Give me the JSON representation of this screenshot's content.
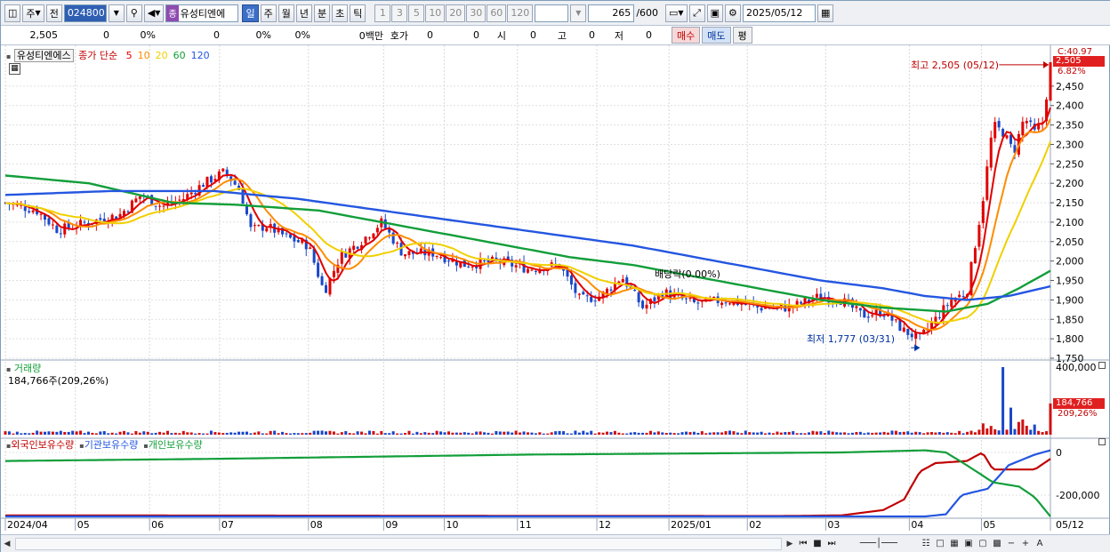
{
  "toolbar": {
    "market": "주",
    "prev_label": "전",
    "code": "024800",
    "search_icon": "search-icon",
    "tag": "종",
    "stock_name": "유성티엔에",
    "periods": [
      "일",
      "주",
      "월",
      "년",
      "분",
      "초",
      "틱"
    ],
    "selected_period": "일",
    "intervals": [
      "1",
      "3",
      "5",
      "10",
      "20",
      "30",
      "60",
      "120"
    ],
    "count": "265",
    "count_total": "/600",
    "date": "2025/05/12"
  },
  "quote": {
    "price": "2,505",
    "change": "0",
    "change_pct": "0%",
    "volume": "0",
    "vol_pct1": "0%",
    "vol_pct2": "0%",
    "amount": "0백만",
    "hoga_label": "호가",
    "hoga_1": "0",
    "hoga_2": "0",
    "open_label": "시",
    "open": "0",
    "high_label": "고",
    "high": "0",
    "low_label": "저",
    "low": "0",
    "buy": "매수",
    "sell": "매도",
    "flat": "평"
  },
  "price_pane": {
    "stock_label": "유성티엔에스",
    "type_label": "종가 단순",
    "ma_labels": [
      "5",
      "10",
      "20",
      "60",
      "120"
    ],
    "ma_colors": [
      "#e00000",
      "#ff8c00",
      "#f0d000",
      "#129e3a",
      "#2456e0"
    ],
    "last_price_box": "2,505",
    "top_right_a": "C:40.97",
    "top_right_b": "6.82%",
    "high_annotation": "최고 2,505 (05/12)",
    "low_annotation": "최저 1,777 (03/31)",
    "dividend_annotation": "배당락(0.00%)"
  },
  "volume_pane": {
    "title": "거래량",
    "subtitle": "184,766주(209,26%)",
    "box_value": "184,766",
    "box_pct": "209,26%",
    "ticks": [
      "400,000"
    ]
  },
  "holdings_pane": {
    "legend": [
      "외국인보유수량",
      "기관보유수량",
      "개인보유수량"
    ],
    "legend_colors": [
      "#c00000",
      "#2456e0",
      "#129e3a"
    ],
    "ticks": [
      "0",
      "-200,000"
    ]
  },
  "x_labels": [
    "2024/04",
    "05",
    "06",
    "07",
    "08",
    "09",
    "10",
    "11",
    "12",
    "2025/01",
    "02",
    "03",
    "04",
    "05",
    "05/12"
  ],
  "chart_data": {
    "type": "candlestick",
    "title": "유성티엔에스",
    "xlabel": "",
    "ylabel": "",
    "ylim": [
      1750,
      2500
    ],
    "y_ticks": [
      2450,
      2400,
      2350,
      2300,
      2250,
      2200,
      2150,
      2100,
      2050,
      2000,
      1950,
      1900,
      1850,
      1800,
      1750
    ],
    "x_axis": [
      "2024/04",
      "05",
      "06",
      "07",
      "08",
      "09",
      "10",
      "11",
      "12",
      "2025/01",
      "02",
      "03",
      "04",
      "05"
    ],
    "high_marker": {
      "label": "최고",
      "value": 2505,
      "date": "05/12"
    },
    "low_marker": {
      "label": "최저",
      "value": 1777,
      "date": "03/31"
    },
    "close_path": [
      {
        "t": 0.0,
        "v": 2150
      },
      {
        "t": 0.03,
        "v": 2130
      },
      {
        "t": 0.05,
        "v": 2080
      },
      {
        "t": 0.08,
        "v": 2100
      },
      {
        "t": 0.11,
        "v": 2120
      },
      {
        "t": 0.13,
        "v": 2170
      },
      {
        "t": 0.15,
        "v": 2140
      },
      {
        "t": 0.17,
        "v": 2160
      },
      {
        "t": 0.19,
        "v": 2200
      },
      {
        "t": 0.21,
        "v": 2230
      },
      {
        "t": 0.225,
        "v": 2180
      },
      {
        "t": 0.235,
        "v": 2080
      },
      {
        "t": 0.25,
        "v": 2090
      },
      {
        "t": 0.27,
        "v": 2060
      },
      {
        "t": 0.29,
        "v": 2040
      },
      {
        "t": 0.305,
        "v": 1920
      },
      {
        "t": 0.32,
        "v": 2010
      },
      {
        "t": 0.34,
        "v": 2050
      },
      {
        "t": 0.36,
        "v": 2100
      },
      {
        "t": 0.38,
        "v": 2020
      },
      {
        "t": 0.41,
        "v": 2020
      },
      {
        "t": 0.44,
        "v": 1990
      },
      {
        "t": 0.47,
        "v": 2000
      },
      {
        "t": 0.5,
        "v": 1980
      },
      {
        "t": 0.53,
        "v": 1990
      },
      {
        "t": 0.55,
        "v": 1900
      },
      {
        "t": 0.57,
        "v": 1910
      },
      {
        "t": 0.59,
        "v": 1960
      },
      {
        "t": 0.61,
        "v": 1880
      },
      {
        "t": 0.63,
        "v": 1920
      },
      {
        "t": 0.66,
        "v": 1890
      },
      {
        "t": 0.69,
        "v": 1900
      },
      {
        "t": 0.72,
        "v": 1880
      },
      {
        "t": 0.75,
        "v": 1880
      },
      {
        "t": 0.78,
        "v": 1910
      },
      {
        "t": 0.8,
        "v": 1900
      },
      {
        "t": 0.82,
        "v": 1860
      },
      {
        "t": 0.84,
        "v": 1870
      },
      {
        "t": 0.86,
        "v": 1820
      },
      {
        "t": 0.875,
        "v": 1800
      },
      {
        "t": 0.89,
        "v": 1850
      },
      {
        "t": 0.905,
        "v": 1900
      },
      {
        "t": 0.92,
        "v": 1920
      },
      {
        "t": 0.935,
        "v": 2150
      },
      {
        "t": 0.945,
        "v": 2350
      },
      {
        "t": 0.955,
        "v": 2330
      },
      {
        "t": 0.965,
        "v": 2280
      },
      {
        "t": 0.975,
        "v": 2370
      },
      {
        "t": 0.985,
        "v": 2330
      },
      {
        "t": 0.993,
        "v": 2360
      },
      {
        "t": 1.0,
        "v": 2505
      }
    ],
    "series": [
      {
        "name": "5",
        "color": "#e00000"
      },
      {
        "name": "10",
        "color": "#ff8c00"
      },
      {
        "name": "20",
        "color": "#f0d000"
      },
      {
        "name": "60",
        "color": "#129e3a",
        "values": [
          [
            0.0,
            2220
          ],
          [
            0.08,
            2200
          ],
          [
            0.16,
            2150
          ],
          [
            0.22,
            2145
          ],
          [
            0.3,
            2130
          ],
          [
            0.38,
            2090
          ],
          [
            0.46,
            2050
          ],
          [
            0.54,
            2010
          ],
          [
            0.6,
            1990
          ],
          [
            0.66,
            1960
          ],
          [
            0.72,
            1930
          ],
          [
            0.78,
            1900
          ],
          [
            0.84,
            1880
          ],
          [
            0.9,
            1870
          ],
          [
            0.94,
            1890
          ],
          [
            0.97,
            1930
          ],
          [
            1.0,
            1975
          ]
        ]
      },
      {
        "name": "120",
        "color": "#2456e0",
        "values": [
          [
            0.0,
            2170
          ],
          [
            0.1,
            2180
          ],
          [
            0.2,
            2180
          ],
          [
            0.28,
            2160
          ],
          [
            0.36,
            2130
          ],
          [
            0.44,
            2100
          ],
          [
            0.52,
            2070
          ],
          [
            0.6,
            2040
          ],
          [
            0.66,
            2010
          ],
          [
            0.72,
            1980
          ],
          [
            0.78,
            1950
          ],
          [
            0.84,
            1930
          ],
          [
            0.88,
            1910
          ],
          [
            0.92,
            1900
          ],
          [
            0.96,
            1910
          ],
          [
            1.0,
            1935
          ]
        ]
      }
    ],
    "volume": {
      "ylim": [
        0,
        400000
      ],
      "baseline_frac": 0.04,
      "spikes": [
        [
          0.955,
          400000
        ],
        [
          0.963,
          160000
        ],
        [
          0.975,
          90000
        ],
        [
          0.985,
          60000
        ],
        [
          1.0,
          184766
        ]
      ]
    },
    "holdings": {
      "ylim": [
        -300000,
        50000
      ],
      "series": [
        {
          "name": "외국인보유수량",
          "color": "#c00000",
          "values": [
            [
              0.0,
              -295000
            ],
            [
              0.74,
              -298000
            ],
            [
              0.8,
              -295000
            ],
            [
              0.84,
              -270000
            ],
            [
              0.86,
              -220000
            ],
            [
              0.875,
              -90000
            ],
            [
              0.89,
              -50000
            ],
            [
              0.92,
              -40000
            ],
            [
              0.935,
              0
            ],
            [
              0.945,
              -80000
            ],
            [
              0.985,
              -80000
            ],
            [
              1.0,
              -30000
            ]
          ]
        },
        {
          "name": "기관보유수량",
          "color": "#2456e0",
          "values": [
            [
              0.0,
              -300000
            ],
            [
              0.88,
              -300000
            ],
            [
              0.9,
              -290000
            ],
            [
              0.915,
              -200000
            ],
            [
              0.94,
              -170000
            ],
            [
              0.96,
              -60000
            ],
            [
              0.985,
              -10000
            ],
            [
              1.0,
              10000
            ]
          ]
        },
        {
          "name": "개인보유수량",
          "color": "#129e3a",
          "values": [
            [
              0.0,
              -40000
            ],
            [
              0.2,
              -30000
            ],
            [
              0.5,
              -10000
            ],
            [
              0.8,
              0
            ],
            [
              0.88,
              10000
            ],
            [
              0.9,
              0
            ],
            [
              0.92,
              -60000
            ],
            [
              0.945,
              -140000
            ],
            [
              0.97,
              -160000
            ],
            [
              0.985,
              -210000
            ],
            [
              1.0,
              -300000
            ]
          ]
        }
      ]
    }
  }
}
